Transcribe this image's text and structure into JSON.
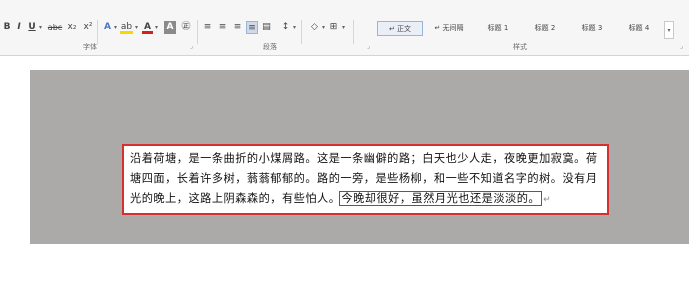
{
  "ribbon": {
    "font_tools": {
      "bold": "B",
      "italic": "I",
      "underline": "U",
      "strikethrough": "abc",
      "subscript": "x₂",
      "superscript": "x²",
      "text_effects": "A",
      "highlight": "ab",
      "font_color": "A",
      "char_shading": "A",
      "enclose": "㊣"
    },
    "groups": {
      "font": "字体",
      "paragraph": "段落",
      "styles": "样式"
    },
    "styles": [
      {
        "label": "正文",
        "marker": "↵",
        "selected": true
      },
      {
        "label": "无间隔",
        "marker": "↵",
        "selected": false
      },
      {
        "label": "标题 1",
        "marker": "",
        "selected": false
      },
      {
        "label": "标题 2",
        "marker": "",
        "selected": false
      },
      {
        "label": "标题 3",
        "marker": "",
        "selected": false
      },
      {
        "label": "标题 4",
        "marker": "",
        "selected": false
      }
    ],
    "colors": {
      "highlight_yellow": "#f5d800",
      "font_red": "#d62020",
      "accent_border": "#d62f2f"
    }
  },
  "document": {
    "lines": [
      {
        "text": "沿着荷塘，是一条曲折的小煤屑路。这是一条幽僻的路；白天也少人走，夜晚更加寂寞。荷"
      },
      {
        "text": "塘四面，长着许多树，蓊蓊郁郁的。路的一旁，是些杨柳，和一些不知道名字的树。没有月"
      },
      {
        "text_before": "光的晚上，这路上阴森森的，有些怕人。",
        "text_selected": "今晚却很好，虽然月光也还是淡淡的。"
      }
    ],
    "pilcrow": "↵"
  }
}
